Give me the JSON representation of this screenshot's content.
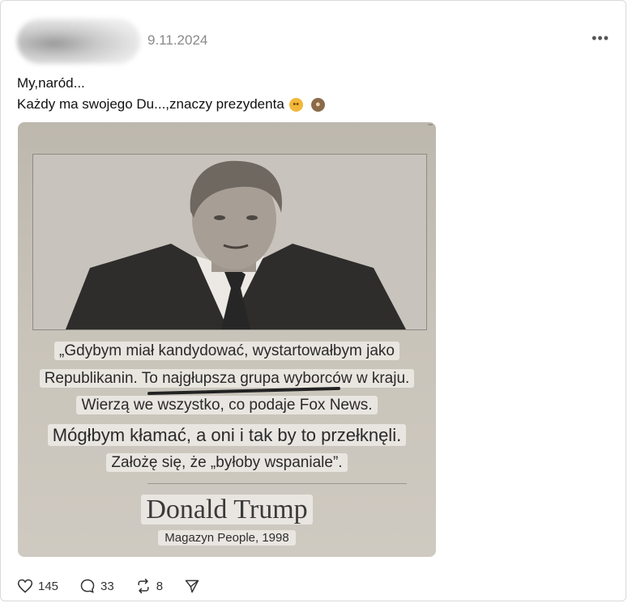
{
  "post": {
    "date": "9.11.2024",
    "more_label": "•••",
    "text_line1": "My,naród...",
    "text_line2": "Każdy ma swojego Du...,znaczy prezydenta",
    "emojis": [
      "sad-face-emoji",
      "see-no-evil-monkey-emoji"
    ]
  },
  "image": {
    "quote": [
      "„Gdybym miał kandydować, wystartowałbym jako",
      "Republikanin. To najgłupsza grupa wyborców w kraju.",
      "Wierzą we wszystko, co podaje Fox News.",
      "Mógłbym kłamać, a oni i tak by to przełknęli.",
      "Założę się, że „byłoby wspaniale”."
    ],
    "author": "Donald Trump",
    "source": "Magazyn People, 1998"
  },
  "actions": {
    "likes": "145",
    "comments": "33",
    "reposts": "8"
  },
  "colors": {
    "muted_text": "#8a8a8a",
    "border": "#d9d9d9"
  }
}
